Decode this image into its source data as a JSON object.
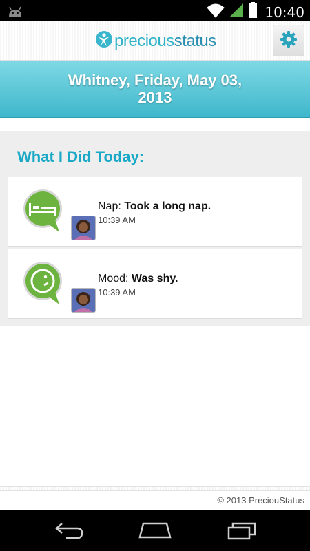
{
  "status_bar": {
    "time": "10:40",
    "icons": [
      "android-icon",
      "wifi-icon",
      "signal-icon",
      "battery-icon"
    ]
  },
  "header": {
    "logo_part1": "precious",
    "logo_part2": "status",
    "settings_icon": "gear-icon"
  },
  "banner": {
    "title": "Whitney, Friday, May 03, 2013"
  },
  "section": {
    "title": "What I Did Today:"
  },
  "activities": [
    {
      "type": "Nap:",
      "value": "Took a long nap.",
      "time": "10:39 AM",
      "icon": "bed-icon"
    },
    {
      "type": "Mood:",
      "value": "Was shy.",
      "time": "10:39 AM",
      "icon": "shy-face-icon"
    }
  ],
  "footer": {
    "copyright": "© 2013 PreciouStatus"
  },
  "nav": {
    "icons": [
      "back-icon",
      "home-icon",
      "recent-apps-icon"
    ]
  },
  "colors": {
    "accent": "#19a9c6",
    "banner": "#3fb7cb",
    "icon_green": "#6cb33f"
  }
}
